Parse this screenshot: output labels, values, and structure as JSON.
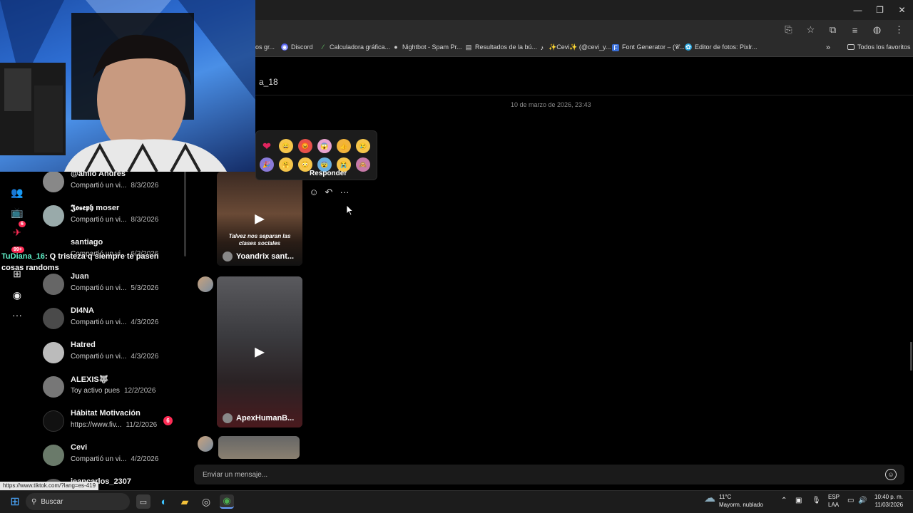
{
  "browser": {
    "window_controls": {
      "minimize": "—",
      "maximize": "❐",
      "close": "✕"
    },
    "toolbar_icons": [
      "install-icon",
      "star-icon",
      "extensions-icon",
      "media-icon",
      "profile-icon",
      "menu-icon"
    ],
    "bookmarks": [
      {
        "label": "os gr...",
        "icon": ""
      },
      {
        "label": "Discord",
        "icon": "◉"
      },
      {
        "label": "Calculadora gráfica...",
        "icon": "⁄"
      },
      {
        "label": "Nightbot - Spam Pr...",
        "icon": "●"
      },
      {
        "label": "Resultados de la bú...",
        "icon": "▤"
      },
      {
        "label": "✨Cevi✨ (@cevi_y...",
        "icon": "♪"
      },
      {
        "label": "Font Generator – (𝓒...",
        "icon": "F"
      },
      {
        "label": "Editor de fotos: Pixlr...",
        "icon": "✿"
      }
    ],
    "more_bookmarks": "»",
    "all_favorites": "Todos los favoritos"
  },
  "thread": {
    "title": "a_18",
    "date": "10 de marzo de 2026, 23:43"
  },
  "rail": {
    "notifications_badge": "6",
    "inbox_badge": "99+"
  },
  "conversations": [
    {
      "name": "@amio Andrés",
      "snippet": "Compartió un vi...",
      "date": "8/3/2026"
    },
    {
      "name": "𝕵𝖔𝖘𝖊𝖕𝖍 moser",
      "snippet": "Compartió un vi...",
      "date": "8/3/2026"
    },
    {
      "name": "santiago",
      "snippet": "Compartió un vi...",
      "date": "6/3/2026"
    },
    {
      "name": "Juan",
      "snippet": "Compartió un vi...",
      "date": "5/3/2026"
    },
    {
      "name": "DI4NA",
      "snippet": "Compartió un vi...",
      "date": "4/3/2026"
    },
    {
      "name": "Hatred",
      "snippet": "Compartió un vi...",
      "date": "4/3/2026"
    },
    {
      "name": "ALEXIS🐺",
      "snippet": "Toy activo pues",
      "date": "12/2/2026"
    },
    {
      "name": "Hábitat Motivación",
      "snippet": "https://www.fiv...",
      "date": "11/2/2026",
      "unread": "6"
    },
    {
      "name": "Cevi",
      "snippet": "Compartió un vi...",
      "date": "4/2/2026"
    },
    {
      "name": "jeancarlos_2307",
      "snippet": "",
      "date": ""
    }
  ],
  "messages": [
    {
      "author": "Yoandrix sant...",
      "overlay": "Talvez nos separan las clases sociales"
    },
    {
      "author": "ApexHumanB..."
    }
  ],
  "reactions": {
    "tooltip": "Responder",
    "row1": [
      "❤",
      "😄",
      "😡",
      "😱",
      "👍",
      "😢"
    ],
    "row2": [
      "🎉",
      "🤗",
      "😳",
      "😨",
      "😭",
      "🙈"
    ]
  },
  "composer": {
    "placeholder": "Enviar un mensaje..."
  },
  "overlay_chat": {
    "user": "TuDiana_16",
    "text": ": Q tristeza q siempre te pasen cosas randoms"
  },
  "status_url": "https://www.tiktok.com/?lang=es-419",
  "taskbar": {
    "search_label": "Buscar",
    "weather_temp": "11°C",
    "weather_desc": "Mayorm. nublado",
    "lang": "ESP",
    "lang2": "LAA",
    "time": "10:40 p. m.",
    "date": "11/03/2026"
  },
  "colors": {
    "accent": "#fe2c55",
    "background": "#000000",
    "panel": "#1a1a1a"
  }
}
